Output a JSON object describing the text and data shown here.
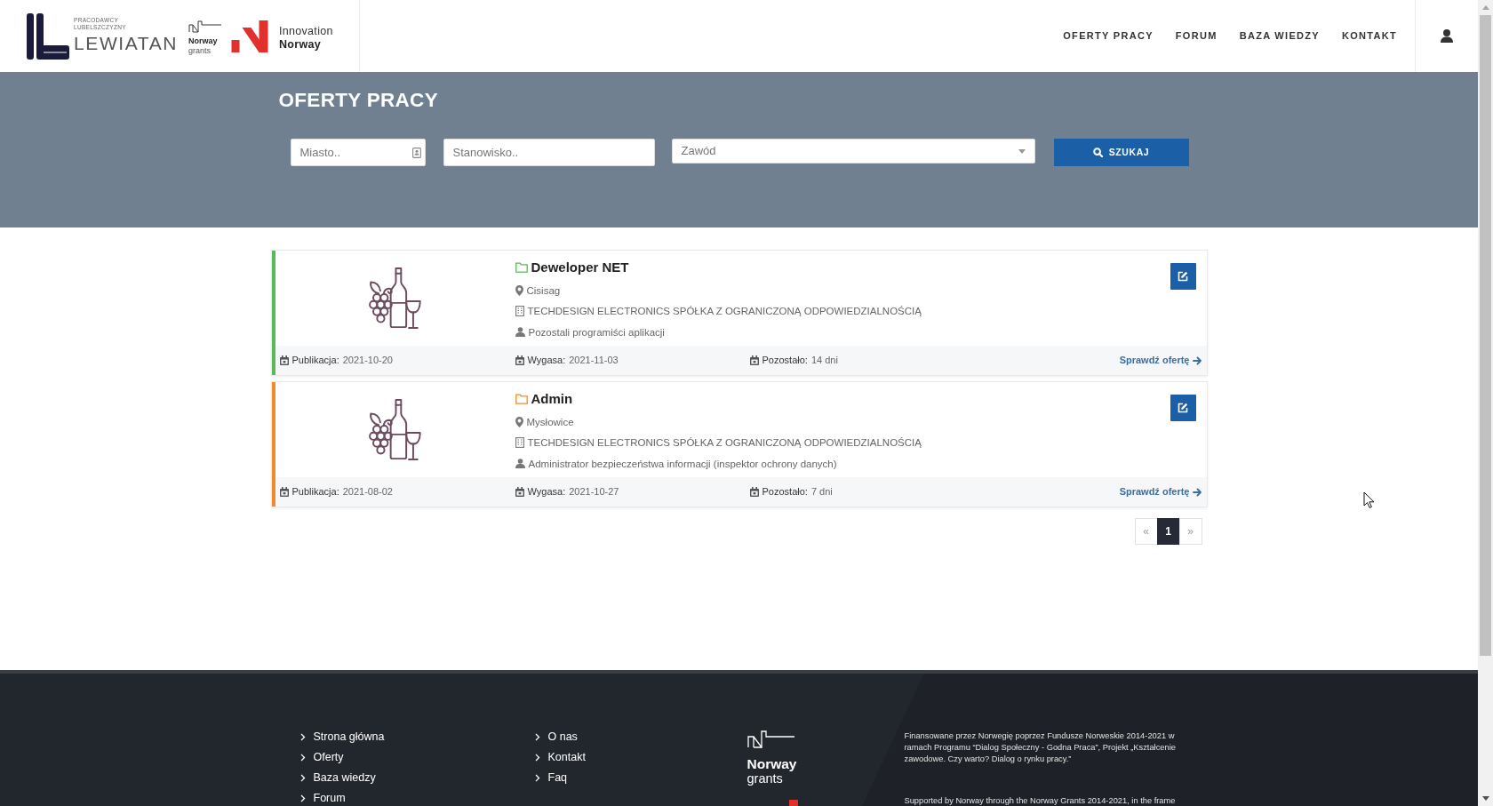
{
  "header": {
    "lewiatan_logo": {
      "tagline": [
        "PRACODAWCY",
        "LUBELSZCZYZNY"
      ],
      "name": "LEWIATAN"
    },
    "norway_grants_logo": [
      "Norway",
      "grants"
    ],
    "innovation_norway_logo": [
      "Innovation",
      "Norway"
    ],
    "nav": [
      "OFERTY PRACY",
      "FORUM",
      "BAZA WIEDZY",
      "KONTAKT"
    ]
  },
  "hero": {
    "title": "OFERTY PRACY",
    "city_field": {
      "placeholder": "Miasto.."
    },
    "position_field": {
      "placeholder": "Stanowisko.."
    },
    "occupation_select": {
      "placeholder": "Zawód"
    },
    "search_button": "SZUKAJ"
  },
  "offers": [
    {
      "color": "#5cb85c",
      "title": "Deweloper NET",
      "location": "Cisisag",
      "company": "TECHDESIGN ELECTRONICS SPÓŁKA Z OGRANICZONĄ ODPOWIEDZIALNOŚCIĄ",
      "occupation": "Pozostali programiści aplikacji",
      "published": {
        "label": "Publikacja:",
        "value": "2021-10-20"
      },
      "expires": {
        "label": "Wygasa:",
        "value": "2021-11-03"
      },
      "remaining": {
        "label": "Pozostało:",
        "value": "14 dni"
      },
      "link": "Sprawdź ofertę"
    },
    {
      "color": "#f08a2c",
      "title": "Admin",
      "location": "Mysłowice",
      "company": "TECHDESIGN ELECTRONICS SPÓŁKA Z OGRANICZONĄ ODPOWIEDZIALNOŚCIĄ",
      "occupation": "Administrator bezpieczeństwa informacji (inspektor ochrony danych)",
      "published": {
        "label": "Publikacja:",
        "value": "2021-08-02"
      },
      "expires": {
        "label": "Wygasa:",
        "value": "2021-10-27"
      },
      "remaining": {
        "label": "Pozostało:",
        "value": "7 dni"
      },
      "link": "Sprawdź ofertę"
    }
  ],
  "pagination": [
    {
      "label": "«",
      "selected": false
    },
    {
      "label": "1",
      "selected": true
    },
    {
      "label": "»",
      "selected": false
    }
  ],
  "footer": {
    "links_1": [
      "Strona główna",
      "Oferty",
      "Baza wiedzy",
      "Forum"
    ],
    "links_2": [
      "O nas",
      "Kontakt",
      "Faq"
    ],
    "logo": [
      "Norway",
      "grants"
    ],
    "text_pl": "Finansowane przez Norwegię poprzez Fundusze Norweskie 2014-2021 w ramach Programu “Dialog Społeczny - Godna Praca”, Projekt „Kształcenie zawodowe. Czy warto? Dialog o rynku pracy.”",
    "text_en": "Supported by Norway through the Norway Grants 2014-2021, in the frame"
  }
}
